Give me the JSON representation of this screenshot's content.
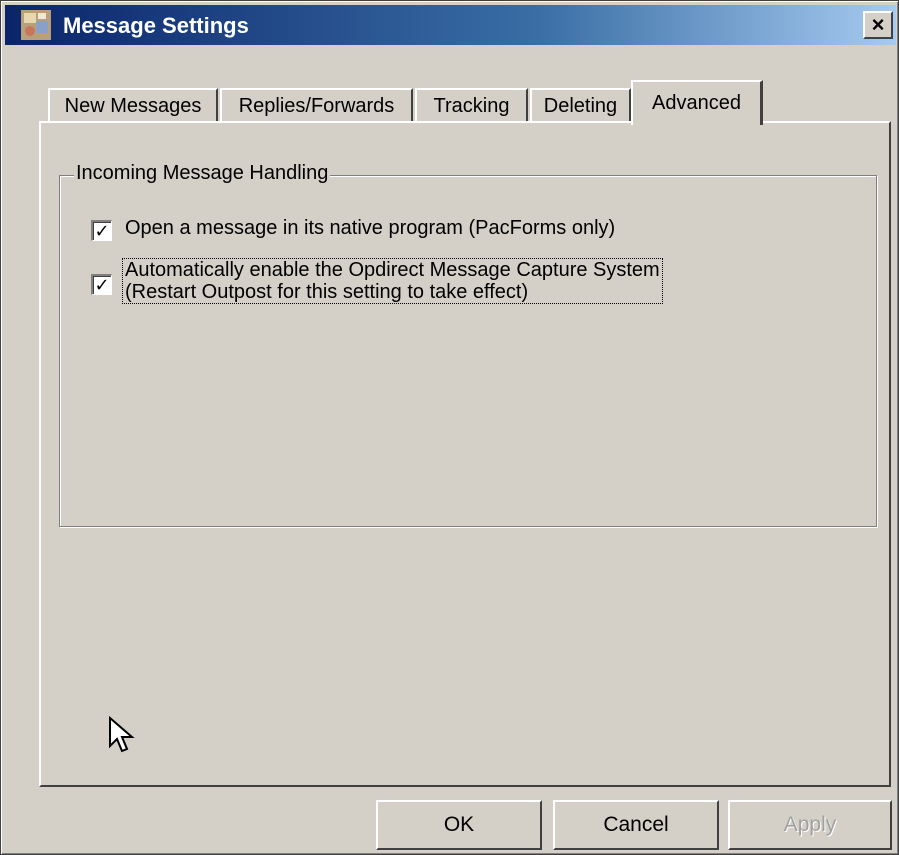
{
  "window": {
    "title": "Message Settings",
    "close_label": "×"
  },
  "tabs": [
    {
      "label": "New Messages",
      "active": false
    },
    {
      "label": "Replies/Forwards",
      "active": false
    },
    {
      "label": "Tracking",
      "active": false
    },
    {
      "label": "Deleting",
      "active": false
    },
    {
      "label": "Advanced",
      "active": true
    }
  ],
  "group": {
    "legend": "Incoming Message Handling",
    "options": [
      {
        "label": "Open a message in its native program (PacForms only)",
        "checked": true
      },
      {
        "line1": "Automatically enable the Opdirect Message Capture System",
        "line2": "(Restart Outpost for this setting to take effect)",
        "checked": true
      }
    ]
  },
  "buttons": {
    "ok": "OK",
    "cancel": "Cancel",
    "apply": "Apply"
  },
  "icons": {
    "app": "app-icon",
    "close": "close-icon",
    "checkmark": "checkmark-icon",
    "cursor": "mouse-pointer-icon"
  },
  "colors": {
    "title_gradient_start": "#0a246a",
    "title_gradient_end": "#a6caf0",
    "face": "#d4d0c8"
  }
}
